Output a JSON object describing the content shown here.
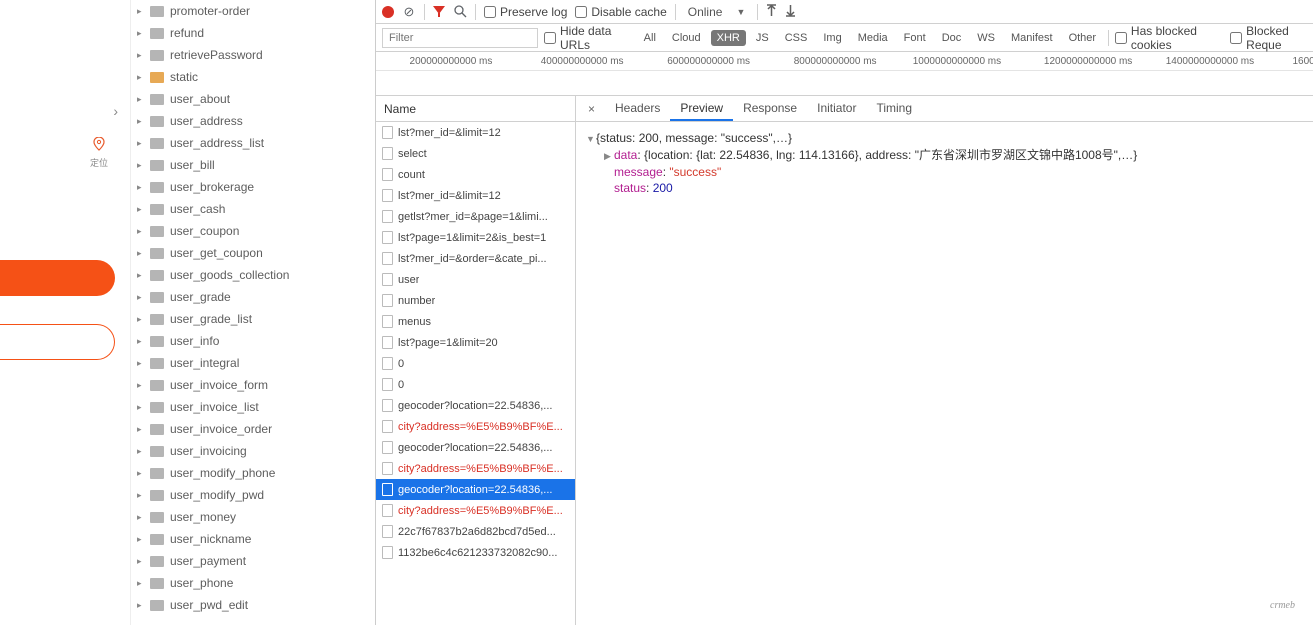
{
  "leftPanel": {
    "pinLabel": "定位"
  },
  "tree": [
    {
      "label": "promoter-order",
      "active": false
    },
    {
      "label": "refund",
      "active": false
    },
    {
      "label": "retrievePassword",
      "active": false
    },
    {
      "label": "static",
      "active": true
    },
    {
      "label": "user_about",
      "active": false
    },
    {
      "label": "user_address",
      "active": false
    },
    {
      "label": "user_address_list",
      "active": false
    },
    {
      "label": "user_bill",
      "active": false
    },
    {
      "label": "user_brokerage",
      "active": false
    },
    {
      "label": "user_cash",
      "active": false
    },
    {
      "label": "user_coupon",
      "active": false
    },
    {
      "label": "user_get_coupon",
      "active": false
    },
    {
      "label": "user_goods_collection",
      "active": false
    },
    {
      "label": "user_grade",
      "active": false
    },
    {
      "label": "user_grade_list",
      "active": false
    },
    {
      "label": "user_info",
      "active": false
    },
    {
      "label": "user_integral",
      "active": false
    },
    {
      "label": "user_invoice_form",
      "active": false
    },
    {
      "label": "user_invoice_list",
      "active": false
    },
    {
      "label": "user_invoice_order",
      "active": false
    },
    {
      "label": "user_invoicing",
      "active": false
    },
    {
      "label": "user_modify_phone",
      "active": false
    },
    {
      "label": "user_modify_pwd",
      "active": false
    },
    {
      "label": "user_money",
      "active": false
    },
    {
      "label": "user_nickname",
      "active": false
    },
    {
      "label": "user_payment",
      "active": false
    },
    {
      "label": "user_phone",
      "active": false
    },
    {
      "label": "user_pwd_edit",
      "active": false
    }
  ],
  "toolbar": {
    "preserveLog": "Preserve log",
    "disableCache": "Disable cache",
    "online": "Online",
    "filterPlaceholder": "Filter",
    "hideDataUrls": "Hide data URLs",
    "hasBlockedCookies": "Has blocked cookies",
    "blockedReq": "Blocked Reque"
  },
  "filterChips": [
    "All",
    "Cloud",
    "XHR",
    "JS",
    "CSS",
    "Img",
    "Media",
    "Font",
    "Doc",
    "WS",
    "Manifest",
    "Other"
  ],
  "filterActive": "XHR",
  "ticks": [
    {
      "t": "200000000000 ms",
      "p": 8
    },
    {
      "t": "400000000000 ms",
      "p": 22
    },
    {
      "t": "600000000000 ms",
      "p": 35.5
    },
    {
      "t": "800000000000 ms",
      "p": 49
    },
    {
      "t": "1000000000000 ms",
      "p": 62
    },
    {
      "t": "1200000000000 ms",
      "p": 76
    },
    {
      "t": "1400000000000 ms",
      "p": 89
    },
    {
      "t": "1600",
      "p": 99
    }
  ],
  "nameHeader": "Name",
  "requests": [
    {
      "n": "lst?mer_id=&limit=12"
    },
    {
      "n": "select"
    },
    {
      "n": "count"
    },
    {
      "n": "lst?mer_id=&limit=12"
    },
    {
      "n": "getlst?mer_id=&page=1&limi..."
    },
    {
      "n": "lst?page=1&limit=2&is_best=1"
    },
    {
      "n": "lst?mer_id=&order=&cate_pi..."
    },
    {
      "n": "user"
    },
    {
      "n": "number"
    },
    {
      "n": "menus"
    },
    {
      "n": "lst?page=1&limit=20"
    },
    {
      "n": "0"
    },
    {
      "n": "0"
    },
    {
      "n": "geocoder?location=22.54836,..."
    },
    {
      "n": "city?address=%E5%B9%BF%E...",
      "red": true
    },
    {
      "n": "geocoder?location=22.54836,..."
    },
    {
      "n": "city?address=%E5%B9%BF%E...",
      "red": true
    },
    {
      "n": "geocoder?location=22.54836,...",
      "sel": true
    },
    {
      "n": "city?address=%E5%B9%BF%E...",
      "red": true
    },
    {
      "n": "22c7f67837b2a6d82bcd7d5ed..."
    },
    {
      "n": "1132be6c4c621233732082c90..."
    }
  ],
  "tabs": [
    "Headers",
    "Preview",
    "Response",
    "Initiator",
    "Timing"
  ],
  "activeTab": "Preview",
  "preview": {
    "summary": "{status: 200, message: \"success\",…}",
    "dataLine": "{location: {lat: 22.54836, lng: 114.13166}, address: \"广东省深圳市罗湖区文锦中路1008号\",…}",
    "messageKey": "message",
    "messageVal": "\"success\"",
    "statusKey": "status",
    "statusVal": "200",
    "dataKey": "data"
  },
  "watermark": "crmeb"
}
